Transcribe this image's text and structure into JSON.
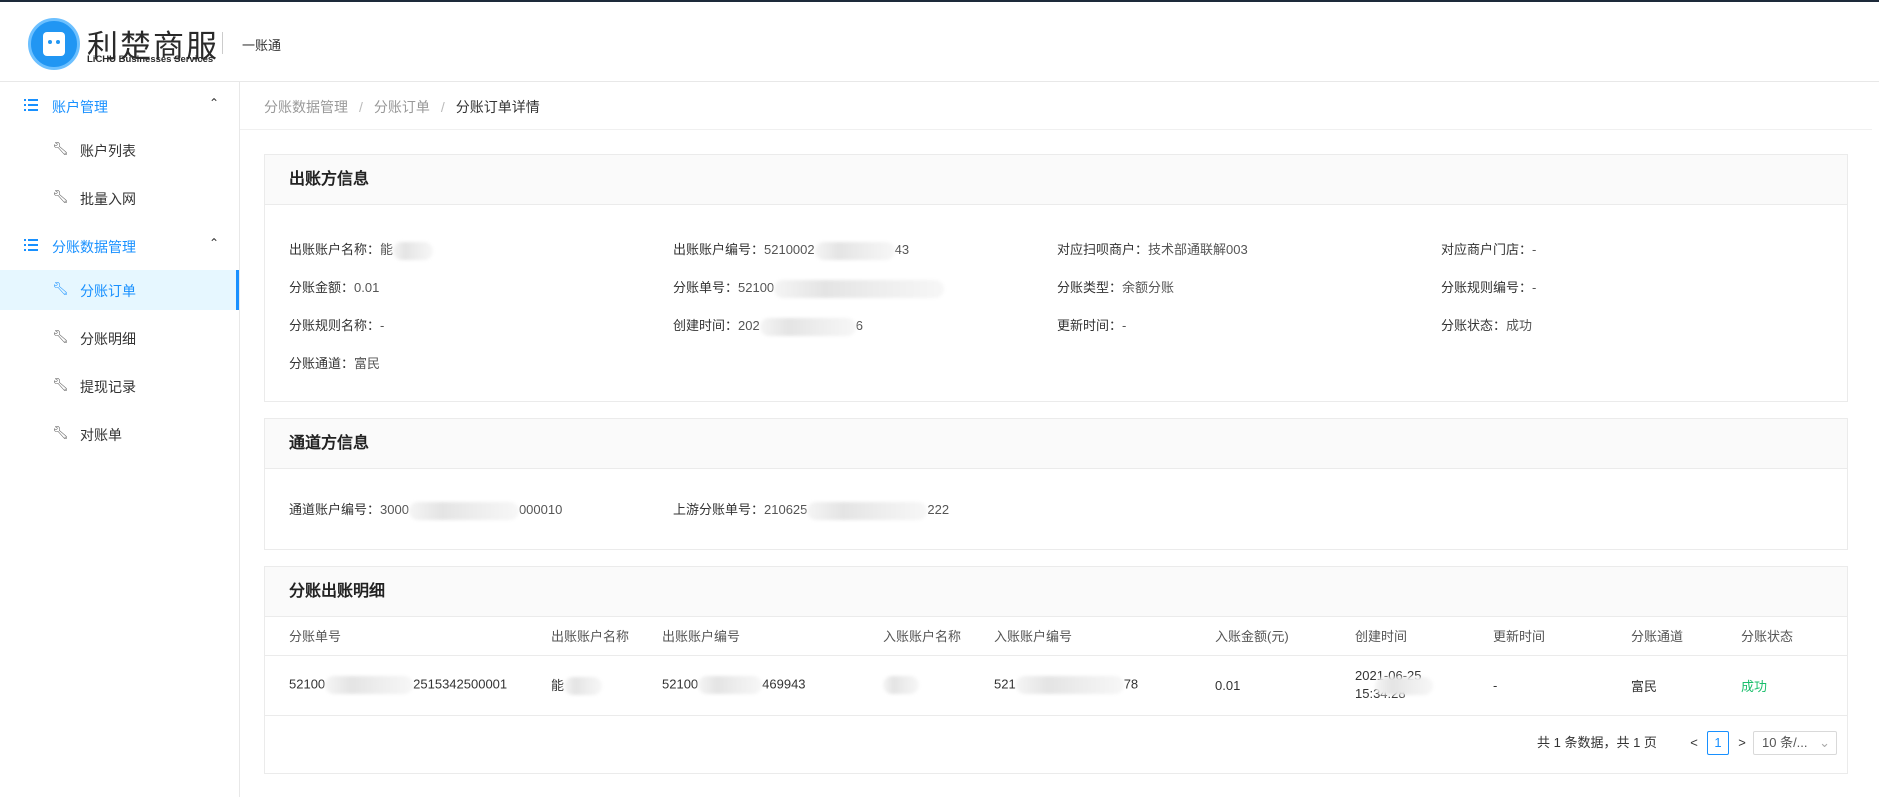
{
  "brand": {
    "name_cn": "利楚商服",
    "name_en": "LiCHU Businesses Services",
    "system": "一账通"
  },
  "sidebar": {
    "groups": [
      {
        "label": "账户管理",
        "items": [
          "账户列表",
          "批量入网"
        ]
      },
      {
        "label": "分账数据管理",
        "items": [
          "分账订单",
          "分账明细",
          "提现记录",
          "对账单"
        ]
      }
    ],
    "active_item": "分账订单"
  },
  "breadcrumb": [
    "分账数据管理",
    "分账订单",
    "分账订单详情"
  ],
  "payer_info": {
    "title": "出账方信息",
    "fields": [
      {
        "label": "出账账户名称：",
        "value": "能"
      },
      {
        "label": "出账账户编号：",
        "value": "5210002",
        "value_suffix": "43"
      },
      {
        "label": "对应扫呗商户：",
        "value": "技术部通联解003"
      },
      {
        "label": "对应商户门店：",
        "value": "-"
      },
      {
        "label": "分账金额：",
        "value": "0.01"
      },
      {
        "label": "分账单号：",
        "value": "52100"
      },
      {
        "label": "分账类型：",
        "value": "余额分账"
      },
      {
        "label": "分账规则编号：",
        "value": "-"
      },
      {
        "label": "分账规则名称：",
        "value": "-"
      },
      {
        "label": "创建时间：",
        "value": "202",
        "value_suffix": "6"
      },
      {
        "label": "更新时间：",
        "value": "-"
      },
      {
        "label": "分账状态：",
        "value": "成功"
      },
      {
        "label": "分账通道：",
        "value": "富民"
      }
    ]
  },
  "channel_info": {
    "title": "通道方信息",
    "fields": [
      {
        "label": "通道账户编号：",
        "value": "3000",
        "value_suffix": "000010"
      },
      {
        "label": "上游分账单号：",
        "value": "210625",
        "value_suffix": "222"
      }
    ]
  },
  "detail_table": {
    "title": "分账出账明细",
    "columns": [
      "分账单号",
      "出账账户名称",
      "出账账户编号",
      "入账账户名称",
      "入账账户编号",
      "入账金额(元)",
      "创建时间",
      "更新时间",
      "分账通道",
      "分账状态"
    ],
    "rows": [
      {
        "order_no": "52100",
        "order_no_suffix": "2515342500001",
        "payer_name": "能",
        "payer_no": "52100",
        "payer_no_suffix": "469943",
        "payee_name": "",
        "payee_no": "521",
        "payee_no_suffix": "78",
        "amount": "0.01",
        "created_line1": "2021-06-25",
        "created_line2": "15:34:28",
        "updated": "-",
        "channel": "富民",
        "status": "成功"
      }
    ]
  },
  "pagination": {
    "summary": "共 1 条数据，共 1 页",
    "prev": "<",
    "page": "1",
    "next": ">",
    "page_size": "10 条/..."
  },
  "colors": {
    "accent": "#1890ff",
    "success": "#19be6b",
    "header_dark": "#1d2a3a"
  }
}
